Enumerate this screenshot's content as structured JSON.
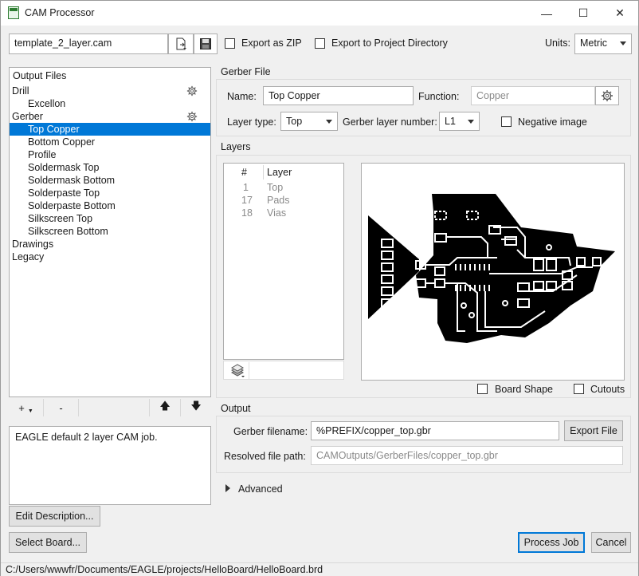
{
  "window": {
    "title": "CAM Processor",
    "minimize": "—",
    "maximize": "☐",
    "close": "✕"
  },
  "toolbar": {
    "job_file": "template_2_layer.cam",
    "export_zip_label": "Export as ZIP",
    "export_project_dir_label": "Export to Project Directory",
    "units_label": "Units:",
    "units_value": "Metric"
  },
  "output_files": {
    "header": "Output Files",
    "items": [
      {
        "label": "Drill",
        "level": 0,
        "selected": false,
        "gear": true
      },
      {
        "label": "Excellon",
        "level": 1,
        "selected": false,
        "gear": false
      },
      {
        "label": "Gerber",
        "level": 0,
        "selected": false,
        "gear": true
      },
      {
        "label": "Top Copper",
        "level": 1,
        "selected": true,
        "gear": false
      },
      {
        "label": "Bottom Copper",
        "level": 1,
        "selected": false,
        "gear": false
      },
      {
        "label": "Profile",
        "level": 1,
        "selected": false,
        "gear": false
      },
      {
        "label": "Soldermask Top",
        "level": 1,
        "selected": false,
        "gear": false
      },
      {
        "label": "Soldermask Bottom",
        "level": 1,
        "selected": false,
        "gear": false
      },
      {
        "label": "Solderpaste Top",
        "level": 1,
        "selected": false,
        "gear": false
      },
      {
        "label": "Solderpaste Bottom",
        "level": 1,
        "selected": false,
        "gear": false
      },
      {
        "label": "Silkscreen Top",
        "level": 1,
        "selected": false,
        "gear": false
      },
      {
        "label": "Silkscreen Bottom",
        "level": 1,
        "selected": false,
        "gear": false
      },
      {
        "label": "Drawings",
        "level": 0,
        "selected": false,
        "gear": false
      },
      {
        "label": "Legacy",
        "level": 0,
        "selected": false,
        "gear": false
      }
    ],
    "add": "+",
    "remove": "-",
    "move_up": "🡅",
    "move_down": "🡇"
  },
  "description": {
    "text": "EAGLE default 2 layer CAM job.",
    "edit_button": "Edit Description..."
  },
  "gerber_file": {
    "section_title": "Gerber File",
    "name_label": "Name:",
    "name_value": "Top Copper",
    "function_label": "Function:",
    "function_value": "Copper",
    "layer_type_label": "Layer type:",
    "layer_type_value": "Top",
    "layer_number_label": "Gerber layer number:",
    "layer_number_value": "L1",
    "negative_label": "Negative image"
  },
  "layers": {
    "section_title": "Layers",
    "col_num": "#",
    "col_layer": "Layer",
    "rows": [
      {
        "num": "1",
        "name": "Top"
      },
      {
        "num": "17",
        "name": "Pads"
      },
      {
        "num": "18",
        "name": "Vias"
      }
    ],
    "board_shape_label": "Board Shape",
    "cutouts_label": "Cutouts"
  },
  "output": {
    "section_title": "Output",
    "filename_label": "Gerber filename:",
    "filename_value": "%PREFIX/copper_top.gbr",
    "export_button": "Export File",
    "resolved_label": "Resolved file path:",
    "resolved_value": "CAMOutputs/GerberFiles/copper_top.gbr"
  },
  "advanced": {
    "label": "Advanced"
  },
  "footer": {
    "select_board": "Select Board...",
    "process_job": "Process Job",
    "cancel": "Cancel",
    "status_path": "C:/Users/wwwfr/Documents/EAGLE/projects/HelloBoard/HelloBoard.brd"
  }
}
